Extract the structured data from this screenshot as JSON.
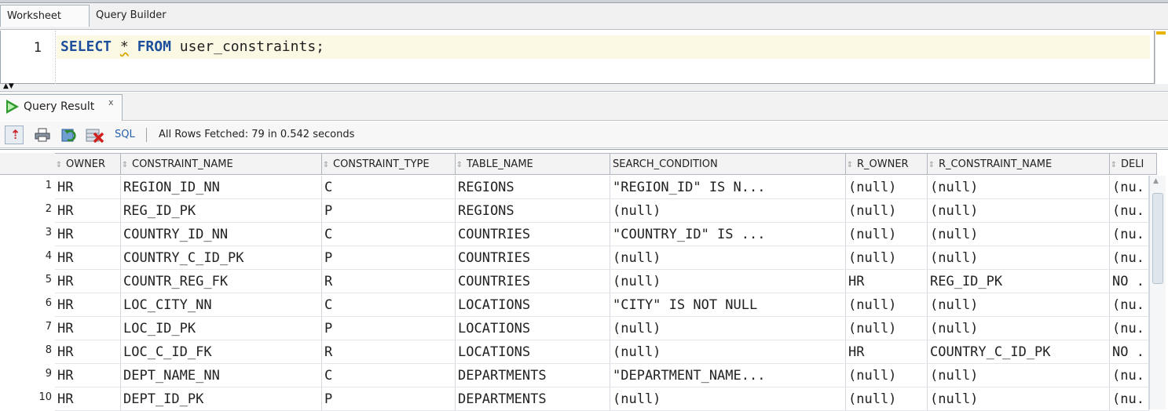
{
  "tabs": {
    "worksheet": "Worksheet",
    "query_builder": "Query Builder"
  },
  "editor": {
    "line_number": "1",
    "kw_select": "SELECT",
    "star": "*",
    "kw_from": "FROM",
    "table_text": "user_constraints;"
  },
  "splitter_icon": "▲▼",
  "result_tab": {
    "label": "Query Result",
    "close": "x"
  },
  "toolbar": {
    "sql_label": "SQL",
    "separator": "|",
    "status": "All Rows Fetched: 79 in 0.542 seconds",
    "icons": [
      "pin-icon",
      "print-icon",
      "refresh-icon",
      "delete-icon"
    ]
  },
  "grid": {
    "columns": [
      "OWNER",
      "CONSTRAINT_NAME",
      "CONSTRAINT_TYPE",
      "TABLE_NAME",
      "SEARCH_CONDITION",
      "R_OWNER",
      "R_CONSTRAINT_NAME",
      "DELI"
    ],
    "rows": [
      [
        "1",
        "HR",
        "REGION_ID_NN",
        "C",
        "REGIONS",
        "\"REGION_ID\" IS N...",
        "(null)",
        "(null)",
        "(nu."
      ],
      [
        "2",
        "HR",
        "REG_ID_PK",
        "P",
        "REGIONS",
        "(null)",
        "(null)",
        "(null)",
        "(nu."
      ],
      [
        "3",
        "HR",
        "COUNTRY_ID_NN",
        "C",
        "COUNTRIES",
        "\"COUNTRY_ID\" IS ...",
        "(null)",
        "(null)",
        "(nu."
      ],
      [
        "4",
        "HR",
        "COUNTRY_C_ID_PK",
        "P",
        "COUNTRIES",
        "(null)",
        "(null)",
        "(null)",
        "(nu."
      ],
      [
        "5",
        "HR",
        "COUNTR_REG_FK",
        "R",
        "COUNTRIES",
        "(null)",
        "HR",
        "REG_ID_PK",
        "NO ."
      ],
      [
        "6",
        "HR",
        "LOC_CITY_NN",
        "C",
        "LOCATIONS",
        "\"CITY\" IS NOT NULL",
        "(null)",
        "(null)",
        "(nu."
      ],
      [
        "7",
        "HR",
        "LOC_ID_PK",
        "P",
        "LOCATIONS",
        "(null)",
        "(null)",
        "(null)",
        "(nu."
      ],
      [
        "8",
        "HR",
        "LOC_C_ID_FK",
        "R",
        "LOCATIONS",
        "(null)",
        "HR",
        "COUNTRY_C_ID_PK",
        "NO ."
      ],
      [
        "9",
        "HR",
        "DEPT_NAME_NN",
        "C",
        "DEPARTMENTS",
        "\"DEPARTMENT_NAME...",
        "(null)",
        "(null)",
        "(nu."
      ],
      [
        "10",
        "HR",
        "DEPT_ID_PK",
        "P",
        "DEPARTMENTS",
        "(null)",
        "(null)",
        "(null)",
        "(nu."
      ]
    ]
  },
  "colors": {
    "keyword": "#1d4f9c",
    "current_line": "#fbf8e4",
    "run_green": "#2f9b2f",
    "pin_red": "#c9202a",
    "link": "#2560b0"
  }
}
